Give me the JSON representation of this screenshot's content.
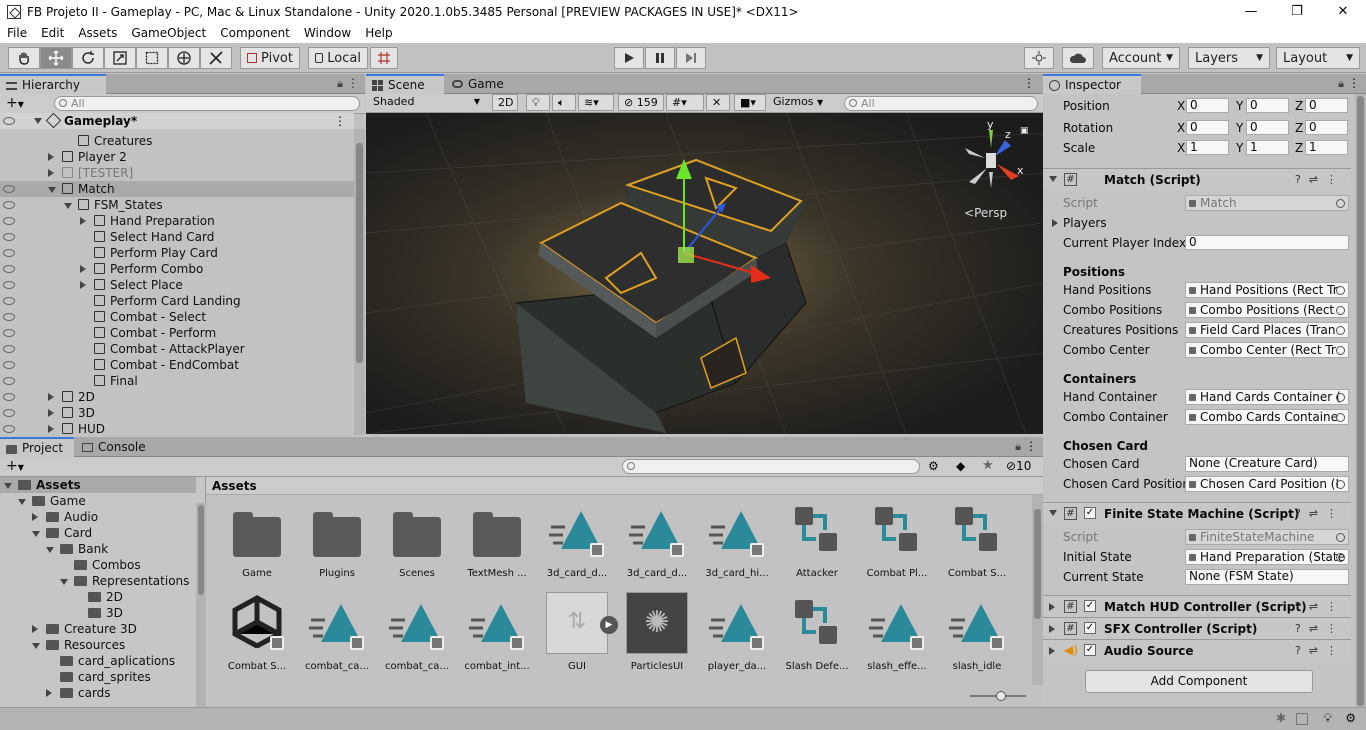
{
  "window": {
    "title": "FB Projeto II - Gameplay - PC, Mac & Linux Standalone - Unity 2020.1.0b5.3485 Personal [PREVIEW PACKAGES IN USE]* <DX11>",
    "minimize": "—",
    "maximize": "❐",
    "close": "✕"
  },
  "menu": [
    "File",
    "Edit",
    "Assets",
    "GameObject",
    "Component",
    "Window",
    "Help"
  ],
  "toolbar": {
    "pivot": "Pivot",
    "local": "Local",
    "account": "Account",
    "layers": "Layers",
    "layout": "Layout"
  },
  "hierarchy": {
    "tab": "Hierarchy",
    "search_placeholder": "All",
    "scene_name": "Gameplay*",
    "rows": [
      {
        "label": "Creatures",
        "indent": 2,
        "arrow": "none",
        "eye": false,
        "selected": false,
        "disabled": false
      },
      {
        "label": "Player 2",
        "indent": 1,
        "arrow": "closed",
        "eye": false,
        "selected": false,
        "disabled": false
      },
      {
        "label": "[TESTER]",
        "indent": 1,
        "arrow": "closed",
        "eye": false,
        "selected": false,
        "disabled": true
      },
      {
        "label": "Match",
        "indent": 1,
        "arrow": "open",
        "eye": true,
        "selected": true,
        "disabled": false
      },
      {
        "label": "FSM_States",
        "indent": 2,
        "arrow": "open",
        "eye": true,
        "selected": false,
        "disabled": false
      },
      {
        "label": "Hand Preparation",
        "indent": 3,
        "arrow": "closed",
        "eye": true,
        "selected": false,
        "disabled": false
      },
      {
        "label": "Select Hand Card",
        "indent": 3,
        "arrow": "none",
        "eye": true,
        "selected": false,
        "disabled": false
      },
      {
        "label": "Perform Play Card",
        "indent": 3,
        "arrow": "none",
        "eye": true,
        "selected": false,
        "disabled": false
      },
      {
        "label": "Perform Combo",
        "indent": 3,
        "arrow": "closed",
        "eye": true,
        "selected": false,
        "disabled": false
      },
      {
        "label": "Select Place",
        "indent": 3,
        "arrow": "closed",
        "eye": true,
        "selected": false,
        "disabled": false
      },
      {
        "label": "Perform Card Landing",
        "indent": 3,
        "arrow": "none",
        "eye": true,
        "selected": false,
        "disabled": false
      },
      {
        "label": "Combat - Select",
        "indent": 3,
        "arrow": "none",
        "eye": true,
        "selected": false,
        "disabled": false
      },
      {
        "label": "Combat - Perform",
        "indent": 3,
        "arrow": "none",
        "eye": true,
        "selected": false,
        "disabled": false
      },
      {
        "label": "Combat - AttackPlayer",
        "indent": 3,
        "arrow": "none",
        "eye": true,
        "selected": false,
        "disabled": false
      },
      {
        "label": "Combat - EndCombat",
        "indent": 3,
        "arrow": "none",
        "eye": true,
        "selected": false,
        "disabled": false
      },
      {
        "label": "Final",
        "indent": 3,
        "arrow": "none",
        "eye": true,
        "selected": false,
        "disabled": false
      },
      {
        "label": "2D",
        "indent": 1,
        "arrow": "closed",
        "eye": true,
        "selected": false,
        "disabled": false
      },
      {
        "label": "3D",
        "indent": 1,
        "arrow": "closed",
        "eye": true,
        "selected": false,
        "disabled": false
      },
      {
        "label": "HUD",
        "indent": 1,
        "arrow": "closed",
        "eye": true,
        "selected": false,
        "disabled": false
      }
    ]
  },
  "scene": {
    "tab_scene": "Scene",
    "tab_game": "Game",
    "shading": "Shaded",
    "mode_2d": "2D",
    "hidden_count": "159",
    "gizmos": "Gizmos",
    "search_placeholder": "All",
    "persp": "Persp",
    "axis_x": "x",
    "axis_y": "y",
    "axis_z": "z"
  },
  "inspector": {
    "tab": "Inspector",
    "transform": {
      "position": {
        "label": "Position",
        "x": "0",
        "y": "0",
        "z": "0"
      },
      "rotation": {
        "label": "Rotation",
        "x": "0",
        "y": "0",
        "z": "0"
      },
      "scale": {
        "label": "Scale",
        "x": "1",
        "y": "1",
        "z": "1"
      }
    },
    "axis": {
      "x": "X",
      "y": "Y",
      "z": "Z"
    },
    "match": {
      "title": "Match (Script)",
      "script_label": "Script",
      "script_value": "Match",
      "players": "Players",
      "current_player_index_label": "Current Player Index",
      "current_player_index": "0",
      "positions_header": "Positions",
      "hand_positions_label": "Hand Positions",
      "hand_positions": "Hand Positions (Rect Tr",
      "combo_positions_label": "Combo Positions",
      "combo_positions": "Combo Positions (Rect",
      "creatures_positions_label": "Creatures Positions",
      "creatures_positions": "Field Card Places (Tran",
      "combo_center_label": "Combo Center",
      "combo_center": "Combo Center (Rect Tr",
      "containers_header": "Containers",
      "hand_container_label": "Hand Container",
      "hand_container": "Hand Cards Container (",
      "combo_container_label": "Combo Container",
      "combo_container": "Combo Cards Containe",
      "chosen_header": "Chosen Card",
      "chosen_card_label": "Chosen Card",
      "chosen_card": "None (Creature Card)",
      "chosen_card_position_label": "Chosen Card Positior",
      "chosen_card_position": "Chosen Card Position (I"
    },
    "fsm": {
      "title": "Finite State Machine (Script)",
      "script_label": "Script",
      "script_value": "FiniteStateMachine",
      "initial_state_label": "Initial State",
      "initial_state": "Hand Preparation (State",
      "current_state_label": "Current State",
      "current_state": "None (FSM State)"
    },
    "collapsed": [
      "Match HUD Controller (Script)",
      "SFX Controller (Script)",
      "Audio Source"
    ],
    "add_component": "Add Component"
  },
  "project": {
    "tab_project": "Project",
    "tab_console": "Console",
    "hidden_count": "10",
    "breadcrumb": "Assets",
    "tree": [
      {
        "label": "Assets",
        "indent": 0,
        "arrow": "open",
        "bold": true
      },
      {
        "label": "Game",
        "indent": 1,
        "arrow": "open",
        "bold": false
      },
      {
        "label": "Audio",
        "indent": 2,
        "arrow": "closed",
        "bold": false
      },
      {
        "label": "Card",
        "indent": 2,
        "arrow": "open",
        "bold": false
      },
      {
        "label": "Bank",
        "indent": 3,
        "arrow": "open",
        "bold": false
      },
      {
        "label": "Combos",
        "indent": 4,
        "arrow": "none",
        "bold": false
      },
      {
        "label": "Representations",
        "indent": 4,
        "arrow": "open",
        "bold": false
      },
      {
        "label": "2D",
        "indent": 5,
        "arrow": "none",
        "bold": false
      },
      {
        "label": "3D",
        "indent": 5,
        "arrow": "none",
        "bold": false
      },
      {
        "label": "Creature 3D",
        "indent": 2,
        "arrow": "closed",
        "bold": false
      },
      {
        "label": "Resources",
        "indent": 2,
        "arrow": "open",
        "bold": false
      },
      {
        "label": "card_aplications",
        "indent": 3,
        "arrow": "none",
        "bold": false
      },
      {
        "label": "card_sprites",
        "indent": 3,
        "arrow": "none",
        "bold": false
      },
      {
        "label": "cards",
        "indent": 3,
        "arrow": "closed",
        "bold": false
      }
    ],
    "assets_row1": [
      {
        "name": "Game",
        "kind": "folder"
      },
      {
        "name": "Plugins",
        "kind": "folder"
      },
      {
        "name": "Scenes",
        "kind": "folder"
      },
      {
        "name": "TextMesh ...",
        "kind": "folder"
      },
      {
        "name": "3d_card_d...",
        "kind": "anim"
      },
      {
        "name": "3d_card_d...",
        "kind": "anim"
      },
      {
        "name": "3d_card_hi...",
        "kind": "anim"
      },
      {
        "name": "Attacker",
        "kind": "controller"
      },
      {
        "name": "Combat Pl...",
        "kind": "controller"
      },
      {
        "name": "Combat S...",
        "kind": "controller"
      }
    ],
    "assets_row2": [
      {
        "name": "Combat S...",
        "kind": "unity"
      },
      {
        "name": "combat_ca...",
        "kind": "anim"
      },
      {
        "name": "combat_ca...",
        "kind": "anim"
      },
      {
        "name": "combat_int...",
        "kind": "anim"
      },
      {
        "name": "GUI",
        "kind": "gui"
      },
      {
        "name": "ParticlesUI",
        "kind": "particles"
      },
      {
        "name": "player_da...",
        "kind": "anim"
      },
      {
        "name": "Slash Defe...",
        "kind": "controller"
      },
      {
        "name": "slash_effe...",
        "kind": "anim"
      },
      {
        "name": "slash_idle",
        "kind": "anim"
      }
    ]
  },
  "colors": {
    "accent": "#3a79d8",
    "teal": "#2a8a9a",
    "selection": "#aaaaaa",
    "gold": "#e0a020"
  }
}
